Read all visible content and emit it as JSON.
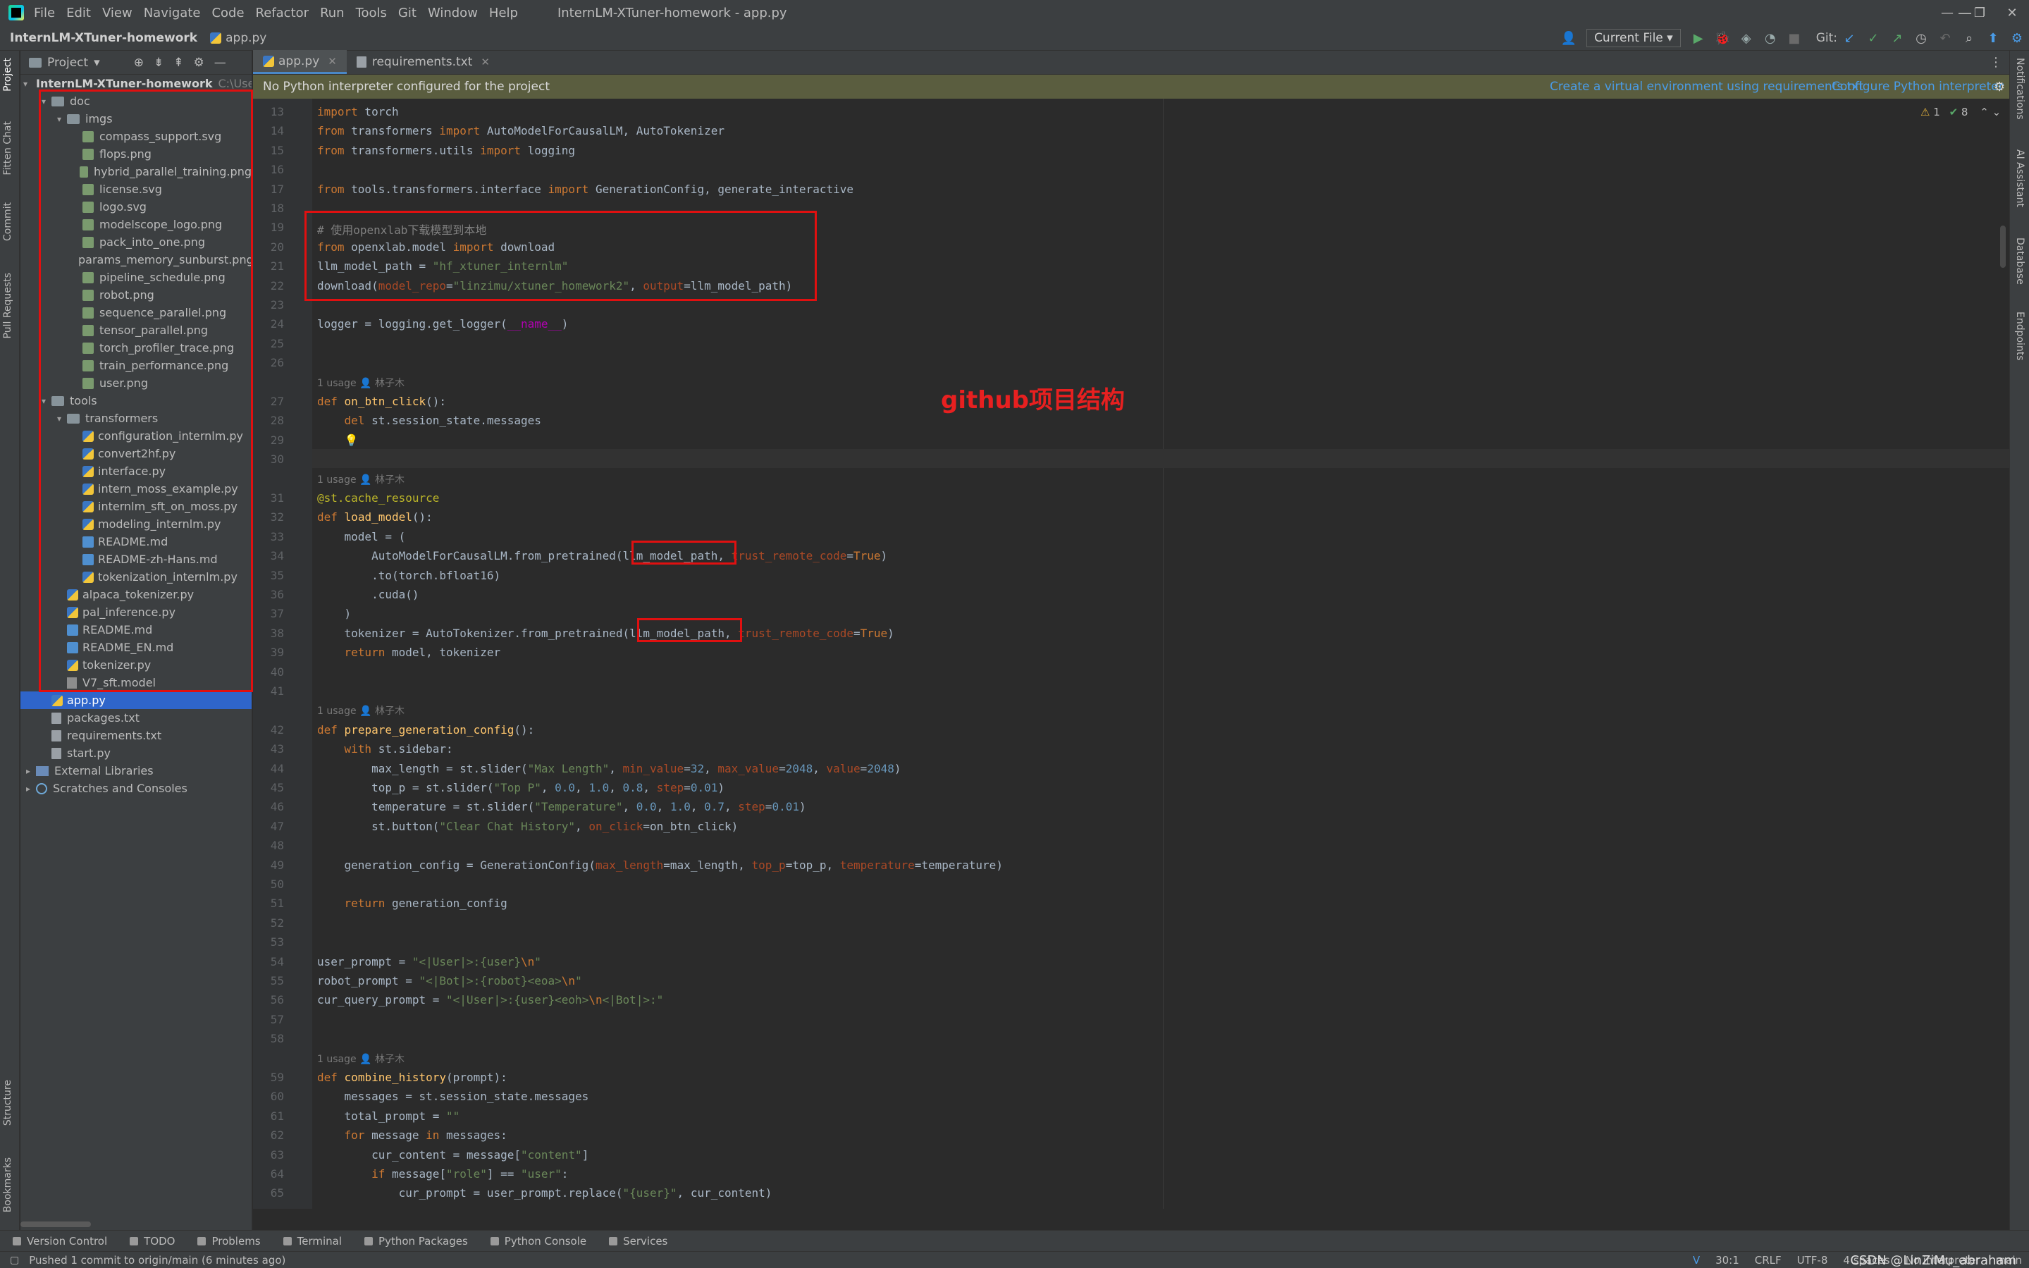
{
  "window": {
    "menu": [
      "File",
      "Edit",
      "View",
      "Navigate",
      "Code",
      "Refactor",
      "Run",
      "Tools",
      "Git",
      "Window",
      "Help"
    ],
    "title": "InternLM-XTuner-homework - app.py",
    "controls": [
      "—",
      "❐",
      "✕"
    ]
  },
  "navbar": {
    "project": "InternLM-XTuner-homework",
    "file": "app.py",
    "run_config": "Current File",
    "git_label": "Git:"
  },
  "left_strip": [
    "Project",
    "Fitten Chat",
    "Commit",
    "Pull Requests",
    "Structure",
    "Bookmarks"
  ],
  "right_strip": [
    "Notifications",
    "AI Assistant",
    "Database",
    "Endpoints"
  ],
  "project_panel": {
    "title": "Project",
    "root": "InternLM-XTuner-homework",
    "root_path": "C:\\Users",
    "rows": [
      {
        "label": "doc",
        "type": "folder",
        "depth": 1,
        "open": true
      },
      {
        "label": "imgs",
        "type": "folder",
        "depth": 2,
        "open": true
      },
      {
        "label": "compass_support.svg",
        "type": "img",
        "depth": 3
      },
      {
        "label": "flops.png",
        "type": "img",
        "depth": 3
      },
      {
        "label": "hybrid_parallel_training.png",
        "type": "img",
        "depth": 3
      },
      {
        "label": "license.svg",
        "type": "img",
        "depth": 3
      },
      {
        "label": "logo.svg",
        "type": "img",
        "depth": 3
      },
      {
        "label": "modelscope_logo.png",
        "type": "img",
        "depth": 3
      },
      {
        "label": "pack_into_one.png",
        "type": "img",
        "depth": 3
      },
      {
        "label": "params_memory_sunburst.png",
        "type": "img",
        "depth": 3
      },
      {
        "label": "pipeline_schedule.png",
        "type": "img",
        "depth": 3
      },
      {
        "label": "robot.png",
        "type": "img",
        "depth": 3
      },
      {
        "label": "sequence_parallel.png",
        "type": "img",
        "depth": 3
      },
      {
        "label": "tensor_parallel.png",
        "type": "img",
        "depth": 3
      },
      {
        "label": "torch_profiler_trace.png",
        "type": "img",
        "depth": 3
      },
      {
        "label": "train_performance.png",
        "type": "img",
        "depth": 3
      },
      {
        "label": "user.png",
        "type": "img",
        "depth": 3
      },
      {
        "label": "tools",
        "type": "folder",
        "depth": 1,
        "open": true
      },
      {
        "label": "transformers",
        "type": "folder",
        "depth": 2,
        "open": true
      },
      {
        "label": "configuration_internlm.py",
        "type": "py",
        "depth": 3
      },
      {
        "label": "convert2hf.py",
        "type": "py",
        "depth": 3
      },
      {
        "label": "interface.py",
        "type": "py",
        "depth": 3
      },
      {
        "label": "intern_moss_example.py",
        "type": "py",
        "depth": 3
      },
      {
        "label": "internlm_sft_on_moss.py",
        "type": "py",
        "depth": 3
      },
      {
        "label": "modeling_internlm.py",
        "type": "py",
        "depth": 3
      },
      {
        "label": "README.md",
        "type": "md",
        "depth": 3
      },
      {
        "label": "README-zh-Hans.md",
        "type": "md",
        "depth": 3
      },
      {
        "label": "tokenization_internlm.py",
        "type": "py",
        "depth": 3
      },
      {
        "label": "alpaca_tokenizer.py",
        "type": "py",
        "depth": 2
      },
      {
        "label": "pal_inference.py",
        "type": "py",
        "depth": 2
      },
      {
        "label": "README.md",
        "type": "md",
        "depth": 2
      },
      {
        "label": "README_EN.md",
        "type": "md",
        "depth": 2
      },
      {
        "label": "tokenizer.py",
        "type": "py",
        "depth": 2
      },
      {
        "label": "V7_sft.model",
        "type": "model",
        "depth": 2
      },
      {
        "label": "app.py",
        "type": "py",
        "depth": 1,
        "selected": true
      },
      {
        "label": "packages.txt",
        "type": "txt",
        "depth": 1
      },
      {
        "label": "requirements.txt",
        "type": "txt",
        "depth": 1
      },
      {
        "label": "start.py",
        "type": "txt",
        "depth": 1
      },
      {
        "label": "External Libraries",
        "type": "lib",
        "depth": 0,
        "closed": true
      },
      {
        "label": "Scratches and Consoles",
        "type": "scratch",
        "depth": 0,
        "closed": true
      }
    ]
  },
  "tabs": [
    {
      "label": "app.py",
      "active": true
    },
    {
      "label": "requirements.txt",
      "active": false
    }
  ],
  "banner": {
    "message": "No Python interpreter configured for the project",
    "link1": "Create a virtual environment using requirements.txt",
    "link2": "Configure Python interpreter"
  },
  "inspections": {
    "warnings": "1",
    "ok": "8"
  },
  "inlays": {
    "usage": "1 usage",
    "author": "林子木"
  },
  "annotation": "github项目结构",
  "bottom_tools": [
    "Version Control",
    "TODO",
    "Problems",
    "Terminal",
    "Python Packages",
    "Python Console",
    "Services"
  ],
  "status": {
    "message": "Pushed 1 commit to origin/main (6 minutes ago)",
    "position": "30:1",
    "line_sep": "CRLF",
    "encoding": "UTF-8",
    "indent": "4 spaces",
    "interpreter": "No interpreter",
    "branch": "main",
    "watermark": "CSDN @LinZiMu_abraham"
  }
}
